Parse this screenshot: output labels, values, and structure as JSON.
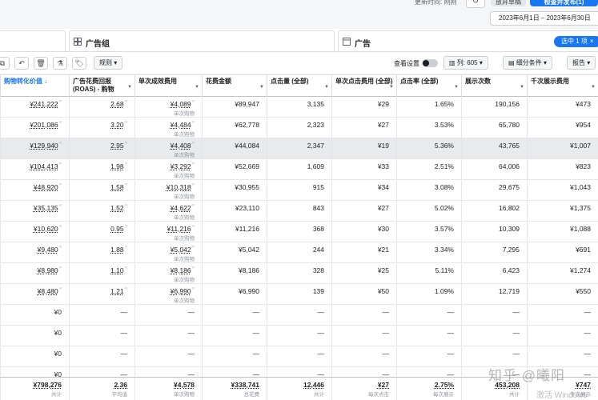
{
  "header": {
    "last_updated": "更新时间: 刚刚",
    "discard_button": "放弃草稿",
    "publish_button": "检查并发布(1)",
    "date_range": "2023年6月1日 – 2023年6月30日"
  },
  "tabs": {
    "adset": "广告组",
    "ad": "广告",
    "selected_pill": "选中 1 项"
  },
  "toolbar": {
    "rules": "规则",
    "view_settings": "查看设置",
    "columns": "列: 605",
    "breakdown": "细分条件",
    "reports": "报告"
  },
  "columns": [
    "购物转化价值",
    "广告花费回报 (ROAS) - 购物",
    "单次成效费用",
    "花费金额",
    "点击量 (全部)",
    "单次点击费用 (全部)",
    "点击率 (全部)",
    "展示次数",
    "千次展示费用"
  ],
  "sub_label_cpa": "单次购物",
  "rows": [
    {
      "c0": "¥241,222",
      "c1": "2.68",
      "c2": "¥4,089",
      "c3": "¥89,947",
      "c4": "3,135",
      "c5": "¥29",
      "c6": "1.65%",
      "c7": "190,156",
      "c8": "¥473"
    },
    {
      "c0": "¥201,086",
      "c1": "3.20",
      "c2": "¥4,484",
      "c3": "¥62,778",
      "c4": "2,323",
      "c5": "¥27",
      "c6": "3.53%",
      "c7": "65,780",
      "c8": "¥954"
    },
    {
      "c0": "¥129,940",
      "c1": "2.95",
      "c2": "¥4,408",
      "c3": "¥44,084",
      "c4": "2,347",
      "c5": "¥19",
      "c6": "5.36%",
      "c7": "43,765",
      "c8": "¥1,007"
    },
    {
      "c0": "¥104,413",
      "c1": "1.98",
      "c2": "¥3,292",
      "c3": "¥52,669",
      "c4": "1,609",
      "c5": "¥33",
      "c6": "2.51%",
      "c7": "64,006",
      "c8": "¥823"
    },
    {
      "c0": "¥48,920",
      "c1": "1.58",
      "c2": "¥10,318",
      "c3": "¥30,955",
      "c4": "915",
      "c5": "¥34",
      "c6": "3.08%",
      "c7": "29,675",
      "c8": "¥1,043"
    },
    {
      "c0": "¥35,135",
      "c1": "1.52",
      "c2": "¥4,622",
      "c3": "¥23,110",
      "c4": "843",
      "c5": "¥27",
      "c6": "5.02%",
      "c7": "16,802",
      "c8": "¥1,375"
    },
    {
      "c0": "¥10,620",
      "c1": "0.95",
      "c2": "¥11,216",
      "c3": "¥11,216",
      "c4": "368",
      "c5": "¥30",
      "c6": "3.57%",
      "c7": "10,309",
      "c8": "¥1,088"
    },
    {
      "c0": "¥9,480",
      "c1": "1.88",
      "c2": "¥5,042",
      "c3": "¥5,042",
      "c4": "244",
      "c5": "¥21",
      "c6": "3.34%",
      "c7": "7,295",
      "c8": "¥691"
    },
    {
      "c0": "¥8,980",
      "c1": "1.10",
      "c2": "¥8,186",
      "c3": "¥8,186",
      "c4": "328",
      "c5": "¥25",
      "c6": "5.11%",
      "c7": "6,423",
      "c8": "¥1,274"
    },
    {
      "c0": "¥8,480",
      "c1": "1.21",
      "c2": "¥6,990",
      "c3": "¥6,990",
      "c4": "139",
      "c5": "¥50",
      "c6": "1.09%",
      "c7": "12,719",
      "c8": "¥550"
    },
    {
      "c0": "¥0",
      "c1": "—",
      "c2": "—",
      "c3": "—",
      "c4": "—",
      "c5": "—",
      "c6": "—",
      "c7": "—",
      "c8": "—"
    },
    {
      "c0": "¥0",
      "c1": "—",
      "c2": "—",
      "c3": "—",
      "c4": "—",
      "c5": "—",
      "c6": "—",
      "c7": "—",
      "c8": "—"
    },
    {
      "c0": "¥0",
      "c1": "—",
      "c2": "—",
      "c3": "—",
      "c4": "—",
      "c5": "—",
      "c6": "—",
      "c7": "—",
      "c8": "—"
    },
    {
      "c0": "¥0",
      "c1": "—",
      "c2": "—",
      "c3": "—",
      "c4": "—",
      "c5": "—",
      "c6": "—",
      "c7": "—",
      "c8": "—"
    }
  ],
  "totals": [
    {
      "v": "¥798,276",
      "sub": "共计"
    },
    {
      "v": "2.36",
      "sub": "平均值"
    },
    {
      "v": "¥4,578",
      "sub": "单次购物"
    },
    {
      "v": "¥338,741",
      "sub": "总花费"
    },
    {
      "v": "12,446",
      "sub": "共计"
    },
    {
      "v": "¥27",
      "sub": "每次点击"
    },
    {
      "v": "2.75%",
      "sub": "每次展示"
    },
    {
      "v": "453,208",
      "sub": "共计"
    },
    {
      "v": "¥747",
      "sub": "千次展示"
    }
  ],
  "watermark": "知乎 @曦阳",
  "watermark2": "激活 Windows"
}
